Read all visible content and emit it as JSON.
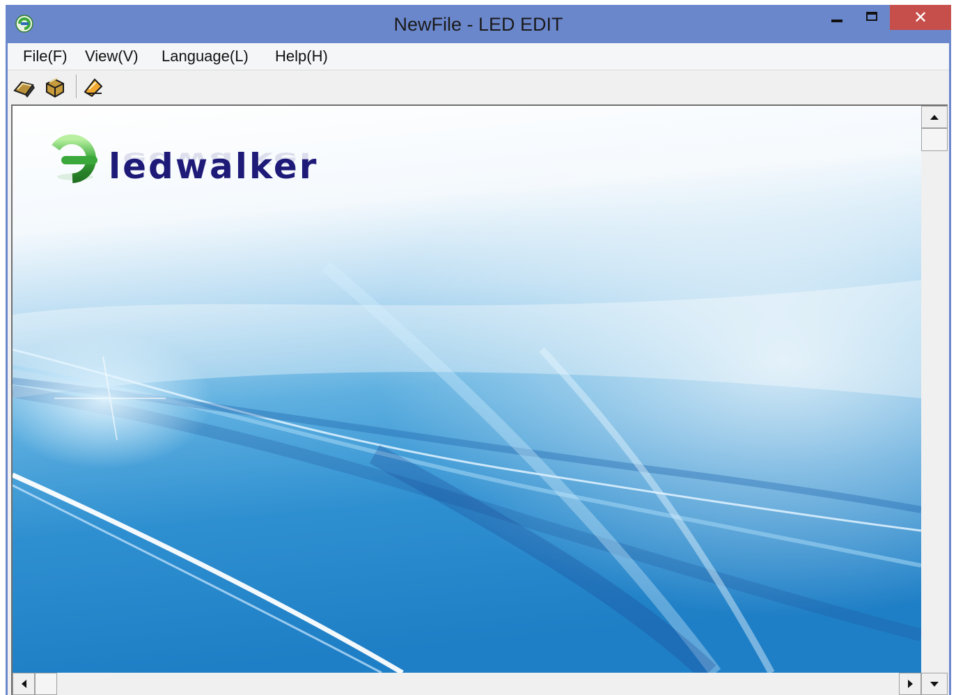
{
  "window": {
    "title": "NewFile - LED EDIT",
    "app_icon": "ledwalker-app-icon",
    "controls": {
      "minimize_icon": "minimize-icon",
      "maximize_icon": "maximize-icon",
      "close_label": "✕"
    }
  },
  "menu": {
    "items": [
      {
        "label": "File(F)"
      },
      {
        "label": "View(V)"
      },
      {
        "label": "Language(L)"
      },
      {
        "label": "Help(H)"
      }
    ]
  },
  "toolbar": {
    "buttons": [
      {
        "icon": "open-file-icon"
      },
      {
        "icon": "save-file-icon"
      },
      {
        "icon": "edit-icon"
      }
    ]
  },
  "splash": {
    "logo_text": "ledwalker"
  },
  "colors": {
    "titlebar": "#6b87cc",
    "close_button": "#c74f4b",
    "logo_text": "#1e1a78",
    "logo_green": "#3aa83a"
  }
}
